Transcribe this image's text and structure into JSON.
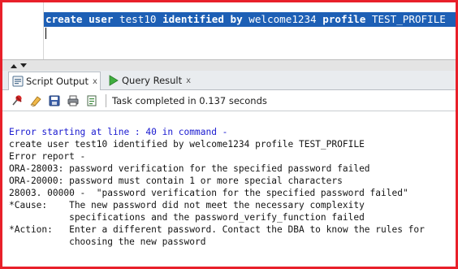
{
  "editor": {
    "sql": {
      "kw1": "create user",
      "t1": " test10 ",
      "kw2": "identified by",
      "t2": " welcome1234 ",
      "kw3": "profile",
      "t3": " TEST_PROFILE"
    }
  },
  "tabs": [
    {
      "label": "Script Output",
      "close": "x",
      "icon": "script-output-icon",
      "active": true
    },
    {
      "label": "Query Result",
      "close": "x",
      "icon": "run-arrow-icon",
      "active": false
    }
  ],
  "toolbar": {
    "icons": [
      "pin-icon",
      "eraser-icon",
      "save-icon",
      "print-icon",
      "export-icon"
    ],
    "status": "Task completed in 0.137 seconds"
  },
  "output": {
    "lines": [
      "Error starting at line : 40 in command -",
      "create user test10 identified by welcome1234 profile TEST_PROFILE",
      "Error report -",
      "ORA-28003: password verification for the specified password failed",
      "ORA-20000: password must contain 1 or more special characters",
      "28003. 00000 -  \"password verification for the specified password failed\"",
      "*Cause:    The new password did not meet the necessary complexity",
      "           specifications and the password_verify_function failed",
      "*Action:   Enter a different password. Contact the DBA to know the rules for",
      "           choosing the new password"
    ]
  },
  "colors": {
    "frame_border": "#e8202a",
    "selection": "#1d5fb5",
    "error_start_text": "#1a1ad0"
  }
}
